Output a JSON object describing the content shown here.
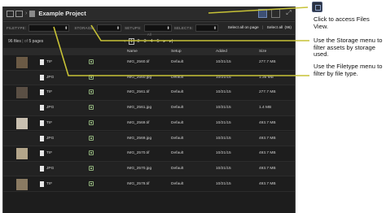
{
  "app": {
    "title": "Example Project",
    "breadcrumb_separator": "›"
  },
  "filters": {
    "filetype_label": "FILETYPE:",
    "storage_label": "STORAGE:",
    "setups_label": "SETUPS:",
    "setups_value": "All",
    "selects_label": "SELECTS:",
    "select_all_page": "Select all on page",
    "select_all": "Select all",
    "select_all_count": "(96)"
  },
  "pagination": {
    "count_text": "96 files",
    "pages_text": "5 pages",
    "current_page": "1",
    "pages": [
      "2",
      "3",
      "4",
      "5"
    ],
    "next": "▸",
    "last": "▸|",
    "prev": "‹"
  },
  "table": {
    "columns": {
      "name": "Name",
      "setup": "Setup",
      "added": "Added",
      "size": "Size"
    },
    "rows": [
      {
        "ext": "TIF",
        "name": "IMG_2560.tif",
        "setup": "Default",
        "added": "10/21/15",
        "size": "277.7 MB",
        "thumb_color": "#6b5a45"
      },
      {
        "ext": "JPG",
        "name": "IMG_2560.jpg",
        "setup": "Default",
        "added": "10/21/15",
        "size": "1.35 MB",
        "thumb_color": ""
      },
      {
        "ext": "TIF",
        "name": "IMG_2561.tif",
        "setup": "Default",
        "added": "10/21/15",
        "size": "277.7 MB",
        "thumb_color": "#5a4f44"
      },
      {
        "ext": "JPG",
        "name": "IMG_2561.jpg",
        "setup": "Default",
        "added": "10/21/15",
        "size": "1.4 MB",
        "thumb_color": ""
      },
      {
        "ext": "TIF",
        "name": "IMG_2569.tif",
        "setup": "Default",
        "added": "10/21/15",
        "size": "493.7 MB",
        "thumb_color": "#c9c0b0"
      },
      {
        "ext": "JPG",
        "name": "IMG_2569.jpg",
        "setup": "Default",
        "added": "10/21/15",
        "size": "493.7 MB",
        "thumb_color": ""
      },
      {
        "ext": "TIF",
        "name": "IMG_2570.tif",
        "setup": "Default",
        "added": "10/21/15",
        "size": "493.7 MB",
        "thumb_color": "#b3a58a"
      },
      {
        "ext": "JPG",
        "name": "IMG_2570.jpg",
        "setup": "Default",
        "added": "10/21/15",
        "size": "493.7 MB",
        "thumb_color": ""
      },
      {
        "ext": "TIF",
        "name": "IMG_2578.tif",
        "setup": "Default",
        "added": "10/21/15",
        "size": "493.7 MB",
        "thumb_color": "#8a7a62"
      }
    ]
  },
  "callouts": {
    "files_view": "Click to access Files View.",
    "storage": "Use the Storage menu to filter assets by storage used.",
    "filetype": "Use the Filetype menu to filter by file type."
  },
  "colors": {
    "accent": "#c7c236",
    "background": "#1d1d1d"
  }
}
